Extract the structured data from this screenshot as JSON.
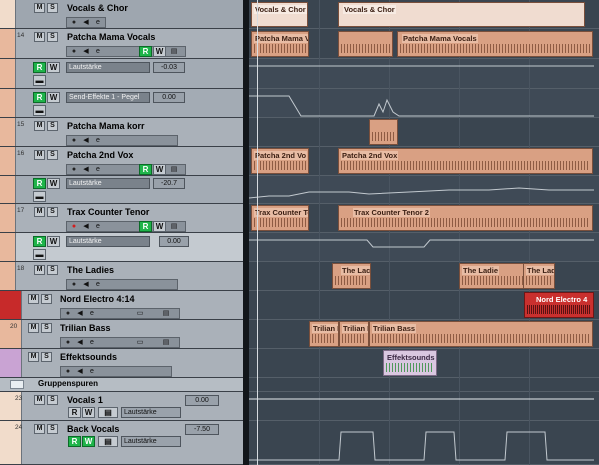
{
  "tracks": {
    "vocals_chor": {
      "name": "Vocals & Chor"
    },
    "patcha_mama_vocals": {
      "num": "14",
      "name": "Patcha Mama Vocals",
      "param": "Lautstärke",
      "value": "-0.03"
    },
    "send_effects": {
      "param": "Send-Effekte 1 - Pegel",
      "value": "0.00"
    },
    "patcha_mama_korr": {
      "num": "15",
      "name": "Patcha Mama korr"
    },
    "patcha_2nd_vox": {
      "num": "16",
      "name": "Patcha 2nd Vox",
      "param": "Lautstärke",
      "value": "-20.7"
    },
    "trax_counter_tenor": {
      "num": "17",
      "name": "Trax Counter Tenor",
      "param": "Lautstärke",
      "value": "0.00"
    },
    "the_ladies": {
      "num": "18",
      "name": "The Ladies"
    },
    "nord_electro": {
      "name": "Nord Electro 4:14"
    },
    "trilian_bass": {
      "num": "20",
      "name": "Trilian Bass"
    },
    "effektsounds": {
      "name": "Effektsounds"
    },
    "gruppenspuren": {
      "name": "Gruppenspuren"
    },
    "vocals_1": {
      "num": "23",
      "name": "Vocals 1",
      "param": "Lautstärke",
      "value": "0.00"
    },
    "back_vocals": {
      "num": "24",
      "name": "Back Vocals",
      "param": "Lautstärke",
      "value": "-7.50"
    }
  },
  "buttons": {
    "mute": "M",
    "solo": "S",
    "read": "R",
    "write": "W"
  },
  "clips": {
    "vocals_chor_a": "Vocals & Chor",
    "vocals_chor_b": "Vocals & Chor",
    "pm_a": "Patcha Mama V",
    "pm_b": "Patcha Mama Vocals",
    "p2_a": "Patcha 2nd Vo",
    "p2_b": "Patcha 2nd Vox",
    "trax_a": "Trax Counter Te",
    "trax_b": "Trax Counter Tenor 2",
    "ladies_a": "The Lac",
    "ladies_b": "The Ladie",
    "ladies_c": "The Lad",
    "nord": "Nord Electro 4",
    "tril_a": "Trilian I",
    "tril_b": "Trilian I",
    "tril_c": "Trilian Bass",
    "effekt": "Effektsounds"
  },
  "colors": {
    "record_red": "#d21e1e",
    "read_green": "#1fb44a",
    "clip_salmon": "#d9a083",
    "nord_red": "#c9302e",
    "effekt_purple": "#d9c7e0"
  }
}
